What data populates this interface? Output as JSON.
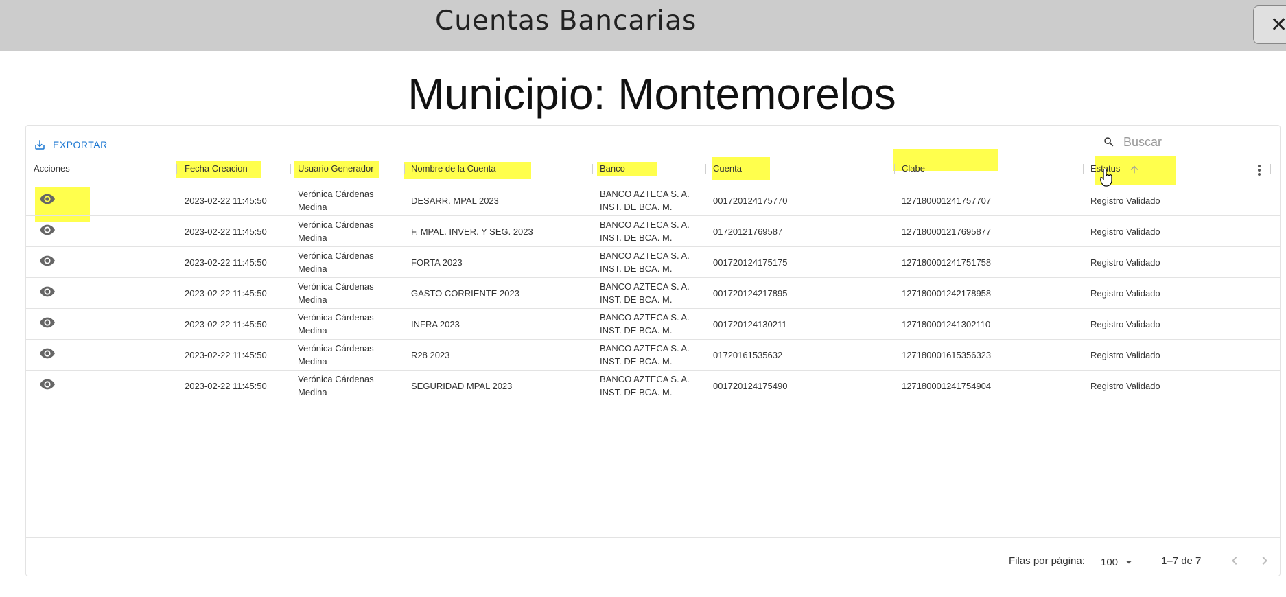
{
  "window": {
    "title": "Cuentas Bancarias",
    "close_label": "✕"
  },
  "page_title": "Municipio: Montemorelos",
  "toolbar": {
    "export_label": "EXPORTAR",
    "search_placeholder": "Buscar",
    "search_value": ""
  },
  "columns": [
    "Acciones",
    "Fecha Creacion",
    "Usuario Generador",
    "Nombre de la Cuenta",
    "Banco",
    "Cuenta",
    "Clabe",
    "Estatus"
  ],
  "sort": {
    "column": "Estatus",
    "direction": "ascending"
  },
  "rows": [
    {
      "fecha": "2023-02-22 11:45:50",
      "usuario_1": "Verónica Cárdenas",
      "usuario_2": "Medina",
      "nombre": "DESARR. MPAL 2023",
      "banco_1": "BANCO AZTECA S. A.",
      "banco_2": "INST. DE BCA. M.",
      "cuenta": "001720124175770",
      "clabe": "127180001241757707",
      "estatus": "Registro Validado"
    },
    {
      "fecha": "2023-02-22 11:45:50",
      "usuario_1": "Verónica Cárdenas",
      "usuario_2": "Medina",
      "nombre": "F. MPAL. INVER. Y SEG. 2023",
      "banco_1": "BANCO AZTECA S. A.",
      "banco_2": "INST. DE BCA. M.",
      "cuenta": "01720121769587",
      "clabe": "127180001217695877",
      "estatus": "Registro Validado"
    },
    {
      "fecha": "2023-02-22 11:45:50",
      "usuario_1": "Verónica Cárdenas",
      "usuario_2": "Medina",
      "nombre": "FORTA 2023",
      "banco_1": "BANCO AZTECA S. A.",
      "banco_2": "INST. DE BCA. M.",
      "cuenta": "001720124175175",
      "clabe": "127180001241751758",
      "estatus": "Registro Validado"
    },
    {
      "fecha": "2023-02-22 11:45:50",
      "usuario_1": "Verónica Cárdenas",
      "usuario_2": "Medina",
      "nombre": "GASTO CORRIENTE 2023",
      "banco_1": "BANCO AZTECA S. A.",
      "banco_2": "INST. DE BCA. M.",
      "cuenta": "001720124217895",
      "clabe": "127180001242178958",
      "estatus": "Registro Validado"
    },
    {
      "fecha": "2023-02-22 11:45:50",
      "usuario_1": "Verónica Cárdenas",
      "usuario_2": "Medina",
      "nombre": "INFRA 2023",
      "banco_1": "BANCO AZTECA S. A.",
      "banco_2": "INST. DE BCA. M.",
      "cuenta": "001720124130211",
      "clabe": "127180001241302110",
      "estatus": "Registro Validado"
    },
    {
      "fecha": "2023-02-22 11:45:50",
      "usuario_1": "Verónica Cárdenas",
      "usuario_2": "Medina",
      "nombre": "R28 2023",
      "banco_1": "BANCO AZTECA S. A.",
      "banco_2": "INST. DE BCA. M.",
      "cuenta": "01720161535632",
      "clabe": "127180001615356323",
      "estatus": "Registro Validado"
    },
    {
      "fecha": "2023-02-22 11:45:50",
      "usuario_1": "Verónica Cárdenas",
      "usuario_2": "Medina",
      "nombre": "SEGURIDAD MPAL 2023",
      "banco_1": "BANCO AZTECA S. A.",
      "banco_2": "INST. DE BCA. M.",
      "cuenta": "001720124175490",
      "clabe": "127180001241754904",
      "estatus": "Registro Validado"
    }
  ],
  "footer": {
    "rows_per_page_label": "Filas por página:",
    "rows_per_page_value": "100",
    "range_label": "1–7 de 7"
  },
  "icons": {
    "export": "download-icon",
    "search": "search-icon",
    "view": "eye-icon",
    "sort": "arrow-up-icon",
    "menu": "kebab-icon",
    "prev": "chevron-left-icon",
    "next": "chevron-right-icon",
    "dropdown": "caret-down-icon"
  },
  "colors": {
    "header_bar": "#cccccc",
    "accent": "#1976d2",
    "highlight": "#ffff4d"
  }
}
